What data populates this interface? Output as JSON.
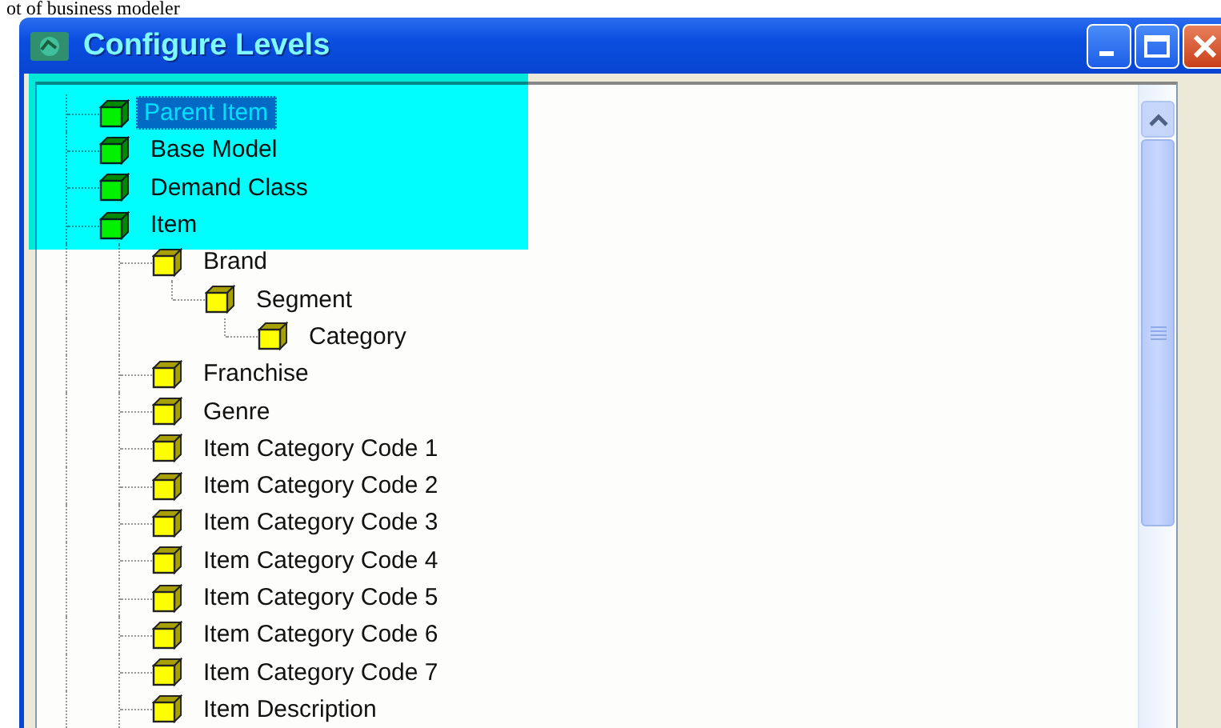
{
  "caption": "ot of business modeler",
  "window": {
    "title": "Configure Levels"
  },
  "tree": [
    {
      "label": "Parent Item",
      "selected": true
    },
    {
      "label": "Base Model",
      "selected": false
    },
    {
      "label": "Demand Class",
      "selected": false
    },
    {
      "label": "Item",
      "selected": false,
      "children": [
        {
          "label": "Brand",
          "selected": false,
          "children": [
            {
              "label": "Segment",
              "selected": false,
              "children": [
                {
                  "label": "Category",
                  "selected": false
                }
              ]
            }
          ]
        },
        {
          "label": "Franchise",
          "selected": false
        },
        {
          "label": "Genre",
          "selected": false
        },
        {
          "label": "Item Category Code 1",
          "selected": false
        },
        {
          "label": "Item Category Code 2",
          "selected": false
        },
        {
          "label": "Item Category Code 3",
          "selected": false
        },
        {
          "label": "Item Category Code 4",
          "selected": false
        },
        {
          "label": "Item Category Code 5",
          "selected": false
        },
        {
          "label": "Item Category Code 6",
          "selected": false
        },
        {
          "label": "Item Category Code 7",
          "selected": false
        },
        {
          "label": "Item Description",
          "selected": false
        }
      ]
    }
  ]
}
